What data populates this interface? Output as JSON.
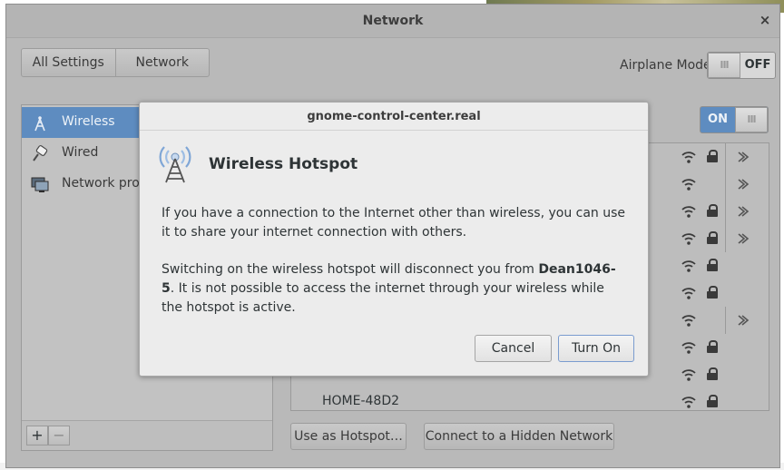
{
  "window": {
    "title": "Network",
    "close_glyph": "×"
  },
  "toolbar": {
    "breadcrumb": [
      "All Settings",
      "Network"
    ],
    "airplane_label": "Airplane Mode",
    "airplane_state": "OFF"
  },
  "sidebar": {
    "items": [
      {
        "label": "Wireless",
        "icon": "wireless-icon",
        "selected": true
      },
      {
        "label": "Wired",
        "icon": "wired-icon",
        "selected": false
      },
      {
        "label": "Network prox",
        "icon": "proxy-icon",
        "selected": false
      }
    ],
    "add_glyph": "+",
    "remove_glyph": "−"
  },
  "wireless": {
    "switch_state": "ON",
    "networks": [
      {
        "ssid": "",
        "secured": true,
        "settings": true
      },
      {
        "ssid": "",
        "secured": false,
        "settings": true
      },
      {
        "ssid": "",
        "secured": true,
        "settings": true
      },
      {
        "ssid": "",
        "secured": true,
        "settings": true
      },
      {
        "ssid": "",
        "secured": true,
        "settings": false
      },
      {
        "ssid": "",
        "secured": true,
        "settings": false
      },
      {
        "ssid": "",
        "secured": false,
        "settings": true
      },
      {
        "ssid": "",
        "secured": true,
        "settings": false
      },
      {
        "ssid": "",
        "secured": true,
        "settings": false
      },
      {
        "ssid": "HOME-48D2",
        "secured": true,
        "settings": false
      }
    ],
    "hotspot_button": "Use as Hotspot…",
    "hidden_button": "Connect to a Hidden Network"
  },
  "dialog": {
    "title": "gnome-control-center.real",
    "heading": "Wireless Hotspot",
    "para1": "If you have a connection to the Internet other than wireless, you can use it to share your internet connection with others.",
    "para2_before": "Switching on the wireless hotspot will disconnect you from ",
    "para2_network": "Dean1046-5",
    "para2_after": ". It is not possible to access the internet through your wireless while the hotspot is active.",
    "cancel_label": "Cancel",
    "turn_on_label": "Turn On"
  },
  "colors": {
    "accent": "#5e8cc0",
    "window_bg": "#b9b9b9",
    "dialog_bg": "#ececec"
  }
}
